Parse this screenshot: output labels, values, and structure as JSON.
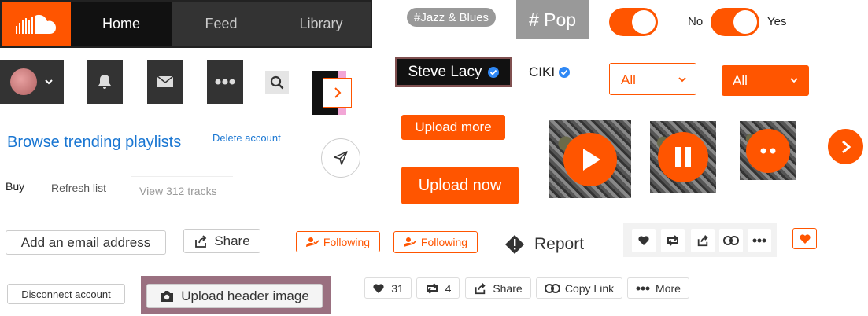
{
  "colors": {
    "accent": "#ff5500",
    "dark": "#333333",
    "link": "#1976d2",
    "verified": "#2f88f5"
  },
  "nav": {
    "tabs": [
      {
        "label": "Home"
      },
      {
        "label": "Feed"
      },
      {
        "label": "Library"
      }
    ]
  },
  "tags": {
    "jazz": "#Jazz & Blues",
    "pop": "# Pop"
  },
  "toggle": {
    "off_label": "No",
    "on_label": "Yes"
  },
  "artists": {
    "steve": "Steve Lacy",
    "ciki": "CIKI"
  },
  "filters": {
    "outline": "All",
    "filled": "All"
  },
  "links": {
    "browse": "Browse trending playlists",
    "delete": "Delete account"
  },
  "tabs_small": {
    "buy": "Buy",
    "refresh": "Refresh list",
    "view": "View 312 tracks"
  },
  "buttons": {
    "upload_more": "Upload more",
    "upload_now": "Upload now",
    "add_email": "Add an email address",
    "share": "Share",
    "following_1": "Following",
    "following_2": "Following",
    "report": "Report",
    "disconnect": "Disconnect account",
    "upload_header": "Upload header image"
  },
  "stats": {
    "likes": "31",
    "reposts": "4",
    "share": "Share",
    "copy": "Copy Link",
    "more": "More"
  }
}
